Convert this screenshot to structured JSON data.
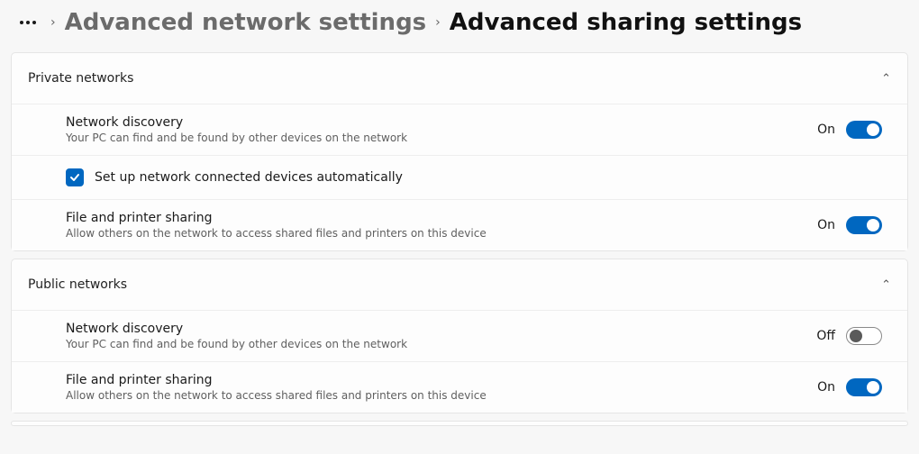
{
  "breadcrumb": {
    "parent": "Advanced network settings",
    "current": "Advanced sharing settings"
  },
  "labels": {
    "on": "On",
    "off": "Off"
  },
  "sections": [
    {
      "id": "private",
      "title": "Private networks",
      "expanded": true,
      "items": [
        {
          "id": "nd",
          "title": "Network discovery",
          "desc": "Your PC can find and be found by other devices on the network",
          "state": "on"
        },
        {
          "id": "auto",
          "type": "checkbox",
          "label": "Set up network connected devices automatically",
          "checked": true
        },
        {
          "id": "fps",
          "title": "File and printer sharing",
          "desc": "Allow others on the network to access shared files and printers on this device",
          "state": "on"
        }
      ]
    },
    {
      "id": "public",
      "title": "Public networks",
      "expanded": true,
      "items": [
        {
          "id": "nd2",
          "title": "Network discovery",
          "desc": "Your PC can find and be found by other devices on the network",
          "state": "off"
        },
        {
          "id": "fps2",
          "title": "File and printer sharing",
          "desc": "Allow others on the network to access shared files and printers on this device",
          "state": "on"
        }
      ]
    }
  ]
}
